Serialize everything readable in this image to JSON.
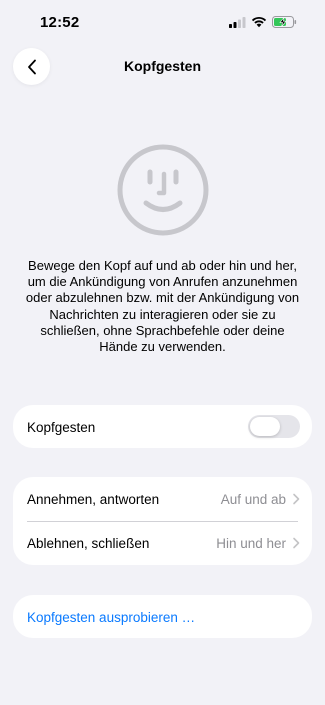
{
  "status_bar": {
    "time": "12:52"
  },
  "nav": {
    "title": "Kopfgesten",
    "back_icon": "chevron-left-icon"
  },
  "header": {
    "icon": "face-smile-icon",
    "description": "Bewege den Kopf auf und ab oder hin und her, um die Ankündigung von Anrufen anzunehmen oder abzulehnen bzw. mit der Ankündigung von Nachrichten zu interagieren oder sie zu schließen, ohne Sprachbefehle oder deine Hände zu verwenden."
  },
  "toggle_section": {
    "label": "Kopfgesten",
    "enabled": false
  },
  "gestures": [
    {
      "label": "Annehmen, antworten",
      "value": "Auf und ab"
    },
    {
      "label": "Ablehnen, schließen",
      "value": "Hin und her"
    }
  ],
  "action": {
    "label": "Kopfgesten ausprobieren …"
  },
  "colors": {
    "background": "#f2f2f7",
    "accent": "#0a7aff",
    "secondary_text": "#8e8e93",
    "toggle_off": "#e5e5ea",
    "battery_charging": "#34c759"
  }
}
